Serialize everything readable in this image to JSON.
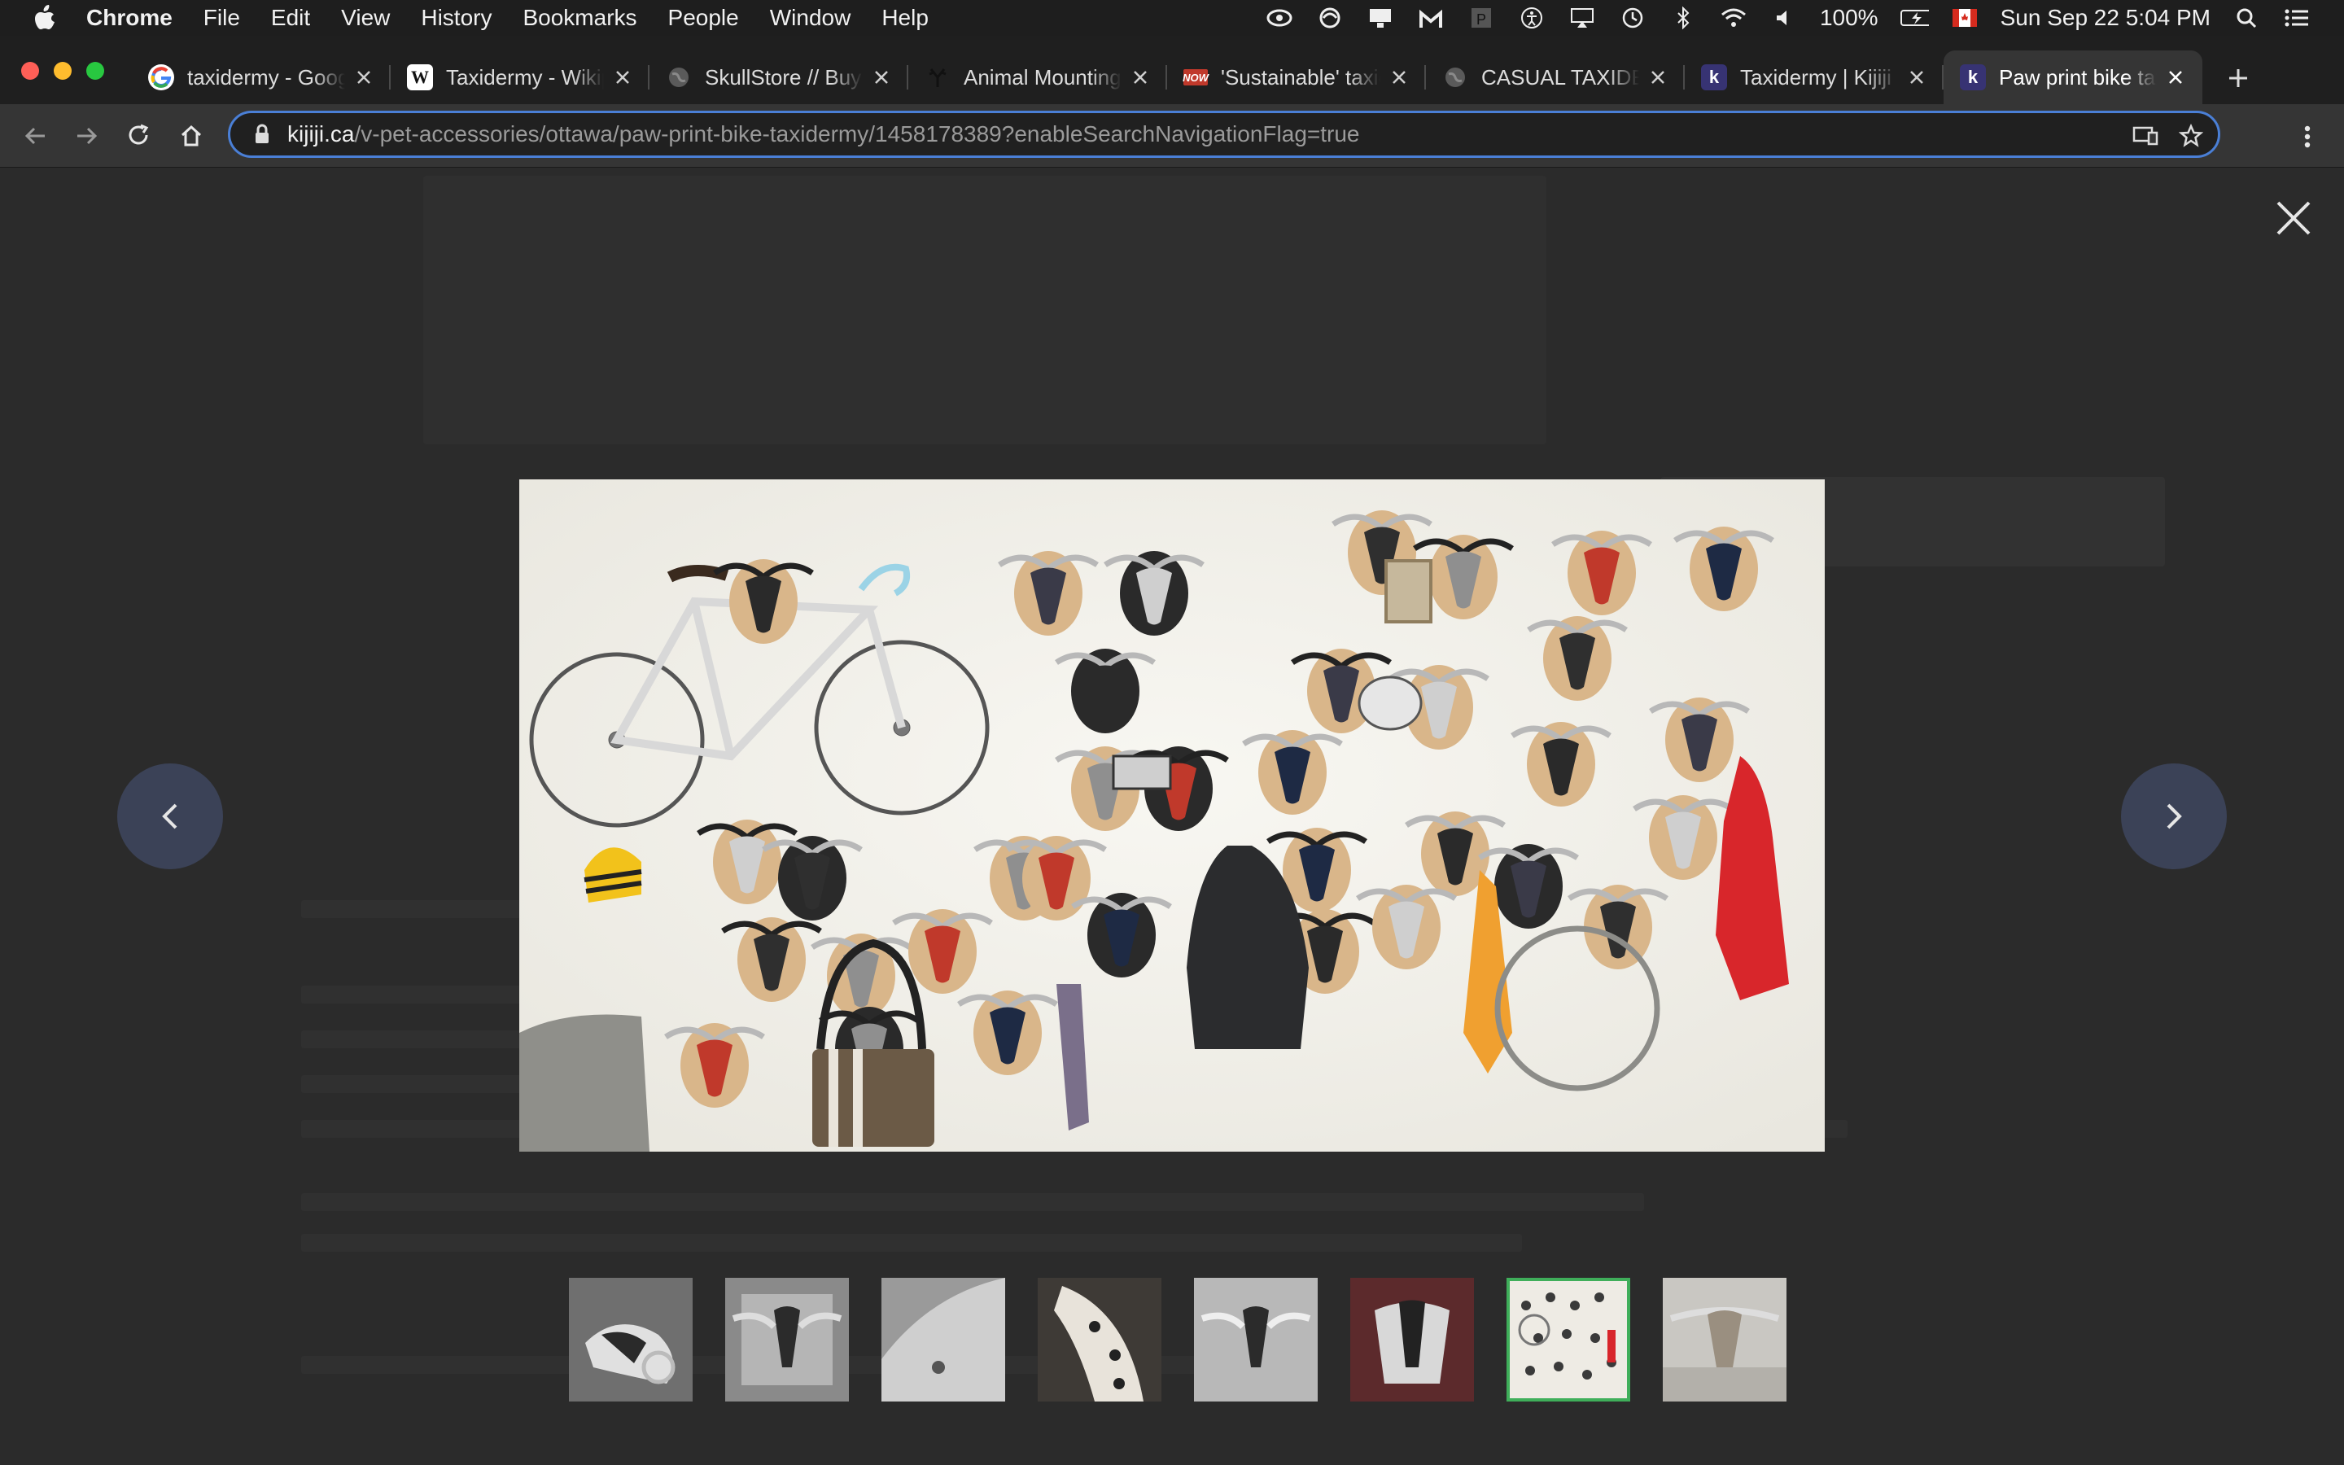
{
  "menubar": {
    "app_name": "Chrome",
    "items": [
      "File",
      "Edit",
      "View",
      "History",
      "Bookmarks",
      "People",
      "Window",
      "Help"
    ],
    "battery": "100%",
    "datetime": "Sun Sep 22  5:04 PM"
  },
  "tabs": [
    {
      "title": "taxidermy - Google Search",
      "favicon": "google-icon",
      "active": false
    },
    {
      "title": "Taxidermy - Wikipedia",
      "favicon": "wikipedia-icon",
      "active": false
    },
    {
      "title": "SkullStore // Buy Skulls",
      "favicon": "globe-icon",
      "active": false
    },
    {
      "title": "Animal Mounting",
      "favicon": "antler-icon",
      "active": false
    },
    {
      "title": "'Sustainable' taxidermy",
      "favicon": "now-icon",
      "active": false
    },
    {
      "title": "CASUAL TAXIDERMY",
      "favicon": "globe-icon",
      "active": false
    },
    {
      "title": "Taxidermy | Kijiji",
      "favicon": "kijiji-icon",
      "active": false
    },
    {
      "title": "Paw print bike taxidermy",
      "favicon": "kijiji-icon",
      "active": true
    }
  ],
  "address": {
    "domain": "kijiji.ca",
    "path": "/v-pet-accessories/ottawa/paw-print-bike-taxidermy/1458178389?enableSearchNavigationFlag=true"
  },
  "gallery": {
    "thumbnail_count": 8,
    "selected_index": 6,
    "accent": "#3fae5a",
    "nav_color": "#3b4257"
  }
}
